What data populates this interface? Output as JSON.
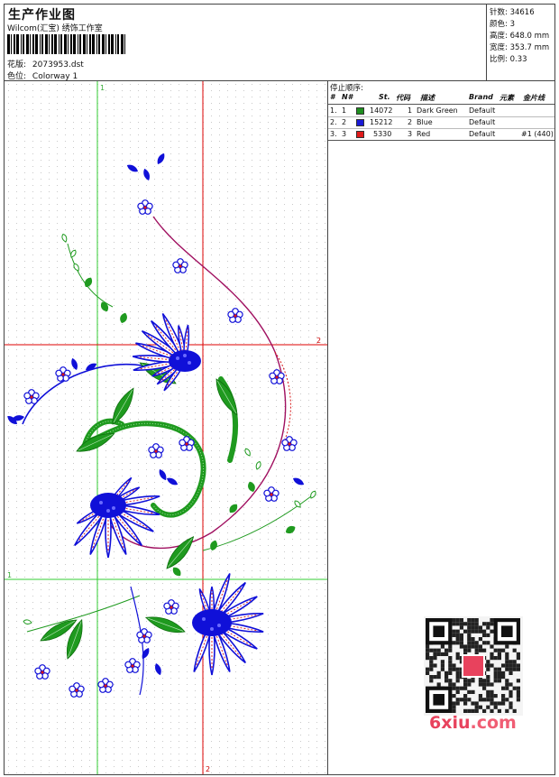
{
  "header": {
    "title": "生产作业图",
    "studio": "Wilcom(汇宝) 绣饰工作室",
    "design_label": "花版:",
    "design_value": "2073953.dst",
    "colorway_label": "色位:",
    "colorway_value": "Colorway 1"
  },
  "stats": {
    "stitches_label": "针数:",
    "stitches_value": "34616",
    "colors_label": "颜色:",
    "colors_value": "3",
    "height_label": "高度:",
    "height_value": "648.0 mm",
    "width_label": "宽度:",
    "width_value": "353.7 mm",
    "scale_label": "比例:",
    "scale_value": "0.33"
  },
  "guides": {
    "v1": "1",
    "h1": "1",
    "h2": "2",
    "v2": "2"
  },
  "stop_sequence": {
    "title": "停止顺序:",
    "columns": [
      "#",
      "N#",
      "St.",
      "代码",
      "描述",
      "Brand",
      "元素",
      "金片线"
    ],
    "rows": [
      {
        "num": "1.",
        "n": "1",
        "color": "#1f8f1f",
        "st": "14072",
        "code": "1",
        "desc": "Dark Green",
        "brand": "Default",
        "element": "",
        "sequin": ""
      },
      {
        "num": "2.",
        "n": "2",
        "color": "#1a1ad6",
        "st": "15212",
        "code": "2",
        "desc": "Blue",
        "brand": "Default",
        "element": "",
        "sequin": ""
      },
      {
        "num": "3.",
        "n": "3",
        "color": "#e01a1a",
        "st": "5330",
        "code": "3",
        "desc": "Red",
        "brand": "Default",
        "element": "",
        "sequin": "#1 (440)"
      }
    ]
  },
  "watermark": {
    "site_a": "6xiu",
    "site_b": ".com"
  },
  "colors": {
    "green": "#1f9a1f",
    "blue": "#1010d8",
    "red": "#d81818",
    "guide_green": "#33cc33",
    "guide_red": "#dd0000"
  }
}
